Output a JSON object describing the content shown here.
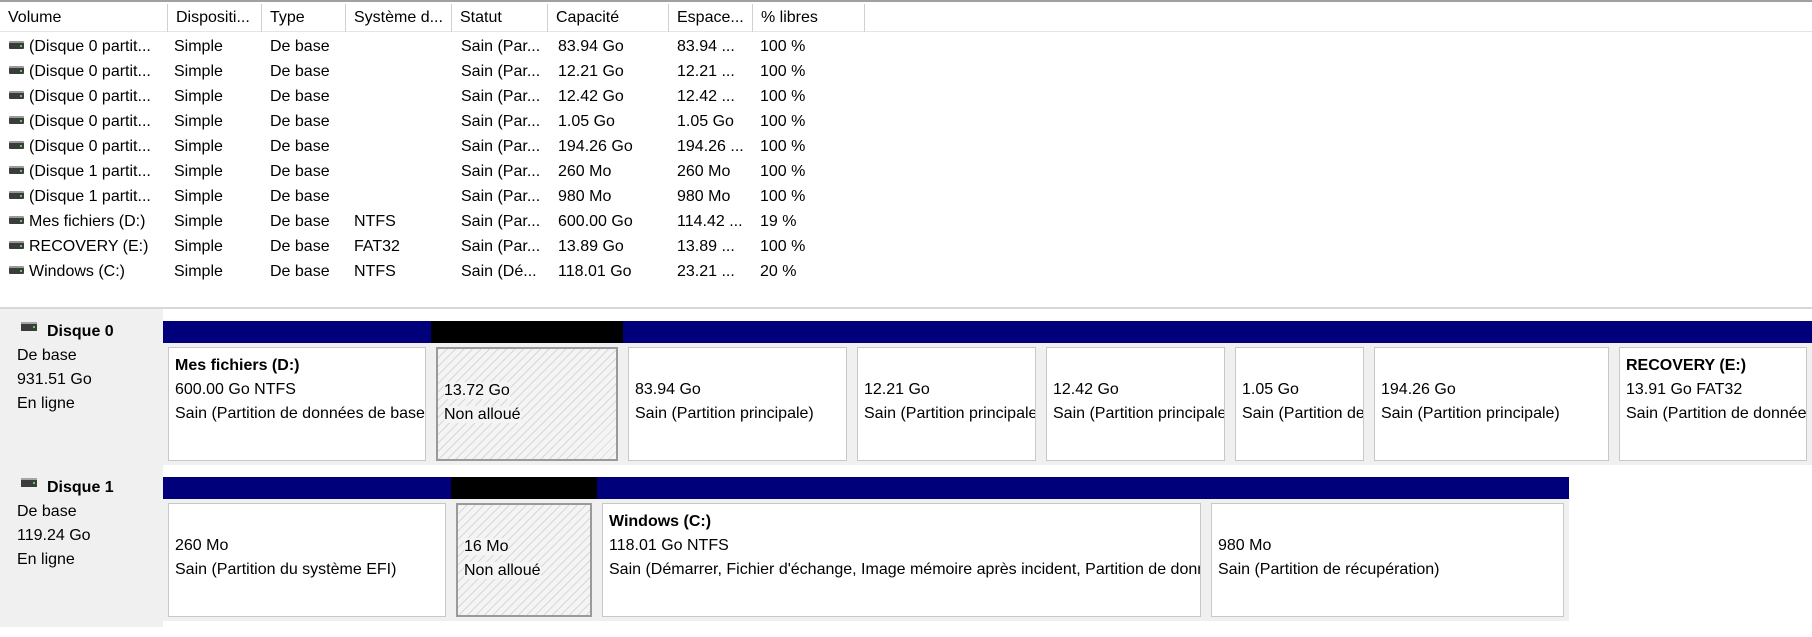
{
  "columns": [
    "Volume",
    "Dispositi...",
    "Type",
    "Système d...",
    "Statut",
    "Capacité",
    "Espace...",
    "% libres"
  ],
  "volumes": [
    {
      "volume": "(Disque 0 partit...",
      "layout": "Simple",
      "type": "De base",
      "fs": "",
      "status": "Sain (Par...",
      "capacity": "83.94 Go",
      "free": "83.94 ...",
      "pct": "100 %"
    },
    {
      "volume": "(Disque 0 partit...",
      "layout": "Simple",
      "type": "De base",
      "fs": "",
      "status": "Sain (Par...",
      "capacity": "12.21 Go",
      "free": "12.21 ...",
      "pct": "100 %"
    },
    {
      "volume": "(Disque 0 partit...",
      "layout": "Simple",
      "type": "De base",
      "fs": "",
      "status": "Sain (Par...",
      "capacity": "12.42 Go",
      "free": "12.42 ...",
      "pct": "100 %"
    },
    {
      "volume": "(Disque 0 partit...",
      "layout": "Simple",
      "type": "De base",
      "fs": "",
      "status": "Sain (Par...",
      "capacity": "1.05 Go",
      "free": "1.05 Go",
      "pct": "100 %"
    },
    {
      "volume": "(Disque 0 partit...",
      "layout": "Simple",
      "type": "De base",
      "fs": "",
      "status": "Sain (Par...",
      "capacity": "194.26 Go",
      "free": "194.26 ...",
      "pct": "100 %"
    },
    {
      "volume": "(Disque 1 partit...",
      "layout": "Simple",
      "type": "De base",
      "fs": "",
      "status": "Sain (Par...",
      "capacity": "260 Mo",
      "free": "260 Mo",
      "pct": "100 %"
    },
    {
      "volume": "(Disque 1 partit...",
      "layout": "Simple",
      "type": "De base",
      "fs": "",
      "status": "Sain (Par...",
      "capacity": "980 Mo",
      "free": "980 Mo",
      "pct": "100 %"
    },
    {
      "volume": "Mes fichiers (D:)",
      "layout": "Simple",
      "type": "De base",
      "fs": "NTFS",
      "status": "Sain (Par...",
      "capacity": "600.00 Go",
      "free": "114.42 ...",
      "pct": "19 %"
    },
    {
      "volume": "RECOVERY (E:)",
      "layout": "Simple",
      "type": "De base",
      "fs": "FAT32",
      "status": "Sain (Par...",
      "capacity": "13.89 Go",
      "free": "13.89 ...",
      "pct": "100 %"
    },
    {
      "volume": "Windows (C:)",
      "layout": "Simple",
      "type": "De base",
      "fs": "NTFS",
      "status": "Sain (Dé...",
      "capacity": "118.01 Go",
      "free": "23.21 ...",
      "pct": "20 %"
    }
  ],
  "disks": [
    {
      "name": "Disque 0",
      "type": "De base",
      "size": "931.51 Go",
      "state": "En ligne",
      "partitions": [
        {
          "kind": "primary",
          "name": "Mes fichiers  (D:)",
          "line1": "600.00 Go NTFS",
          "line2": "Sain (Partition de données de base)"
        },
        {
          "kind": "unallocated",
          "name": "",
          "line1": "13.72 Go",
          "line2": "Non alloué"
        },
        {
          "kind": "primary",
          "name": "",
          "line1": "83.94 Go",
          "line2": "Sain (Partition principale)"
        },
        {
          "kind": "primary",
          "name": "",
          "line1": "12.21 Go",
          "line2": "Sain (Partition principale)"
        },
        {
          "kind": "primary",
          "name": "",
          "line1": "12.42 Go",
          "line2": "Sain (Partition principale)"
        },
        {
          "kind": "primary",
          "name": "",
          "line1": "1.05 Go",
          "line2": "Sain (Partition de récupération)"
        },
        {
          "kind": "primary",
          "name": "",
          "line1": "194.26 Go",
          "line2": "Sain (Partition principale)"
        },
        {
          "kind": "primary",
          "name": "RECOVERY  (E:)",
          "line1": "13.91 Go FAT32",
          "line2": "Sain (Partition de données de base)"
        }
      ]
    },
    {
      "name": "Disque 1",
      "type": "De base",
      "size": "119.24 Go",
      "state": "En ligne",
      "partitions": [
        {
          "kind": "primary",
          "name": "",
          "line1": "260 Mo",
          "line2": "Sain (Partition du système EFI)"
        },
        {
          "kind": "unallocated",
          "name": "",
          "line1": "16 Mo",
          "line2": "Non alloué"
        },
        {
          "kind": "primary",
          "name": "Windows  (C:)",
          "line1": "118.01 Go NTFS",
          "line2": "Sain (Démarrer, Fichier d'échange, Image mémoire après incident, Partition de données de base)"
        },
        {
          "kind": "primary",
          "name": "",
          "line1": "980 Mo",
          "line2": "Sain (Partition de récupération)"
        }
      ]
    }
  ]
}
